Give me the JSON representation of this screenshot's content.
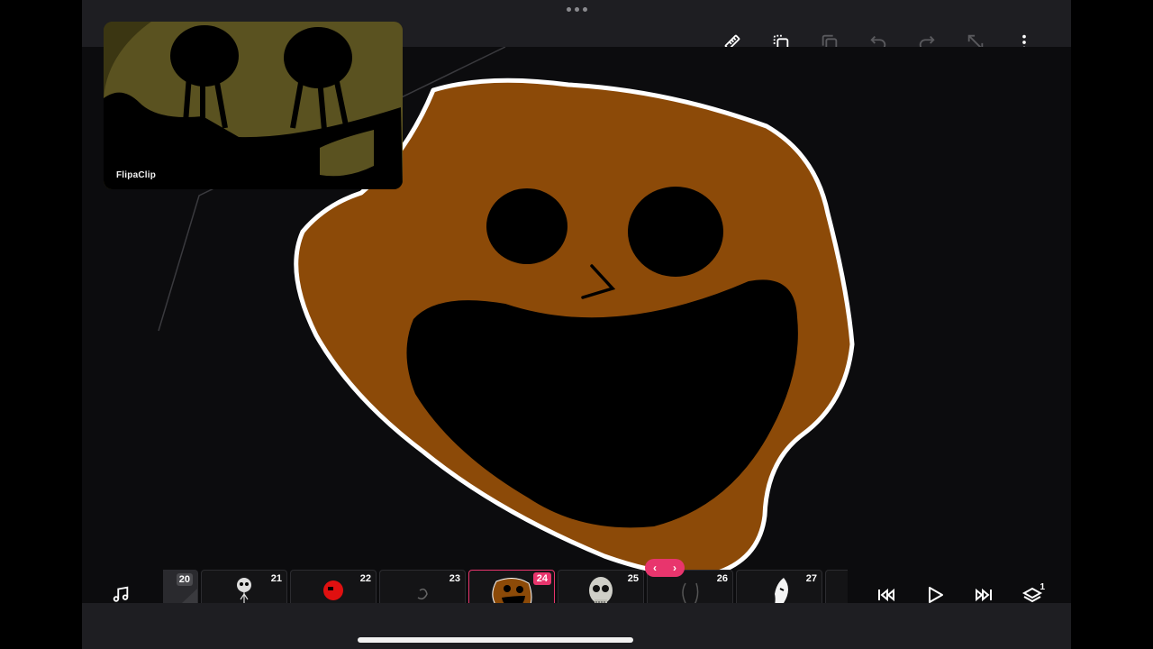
{
  "app": {
    "accent_color": "#e8356d",
    "background": "#0c0c0e"
  },
  "toolbar": {
    "icons": [
      "ruler-icon",
      "duplicate-layer-icon",
      "copy-icon",
      "undo-icon",
      "redo-icon",
      "resize-icon",
      "more-options-icon"
    ]
  },
  "reference_panel": {
    "watermark": "FlipaClip"
  },
  "timeline": {
    "frames": [
      {
        "number": "20"
      },
      {
        "number": "21"
      },
      {
        "number": "22"
      },
      {
        "number": "23"
      },
      {
        "number": "24",
        "selected": true
      },
      {
        "number": "25"
      },
      {
        "number": "26"
      },
      {
        "number": "27"
      }
    ],
    "nav_left": "‹",
    "nav_right": "›",
    "controls": [
      "skip-to-start-icon",
      "play-icon",
      "skip-to-end-icon",
      "layers-icon"
    ],
    "layers_count": "1"
  }
}
